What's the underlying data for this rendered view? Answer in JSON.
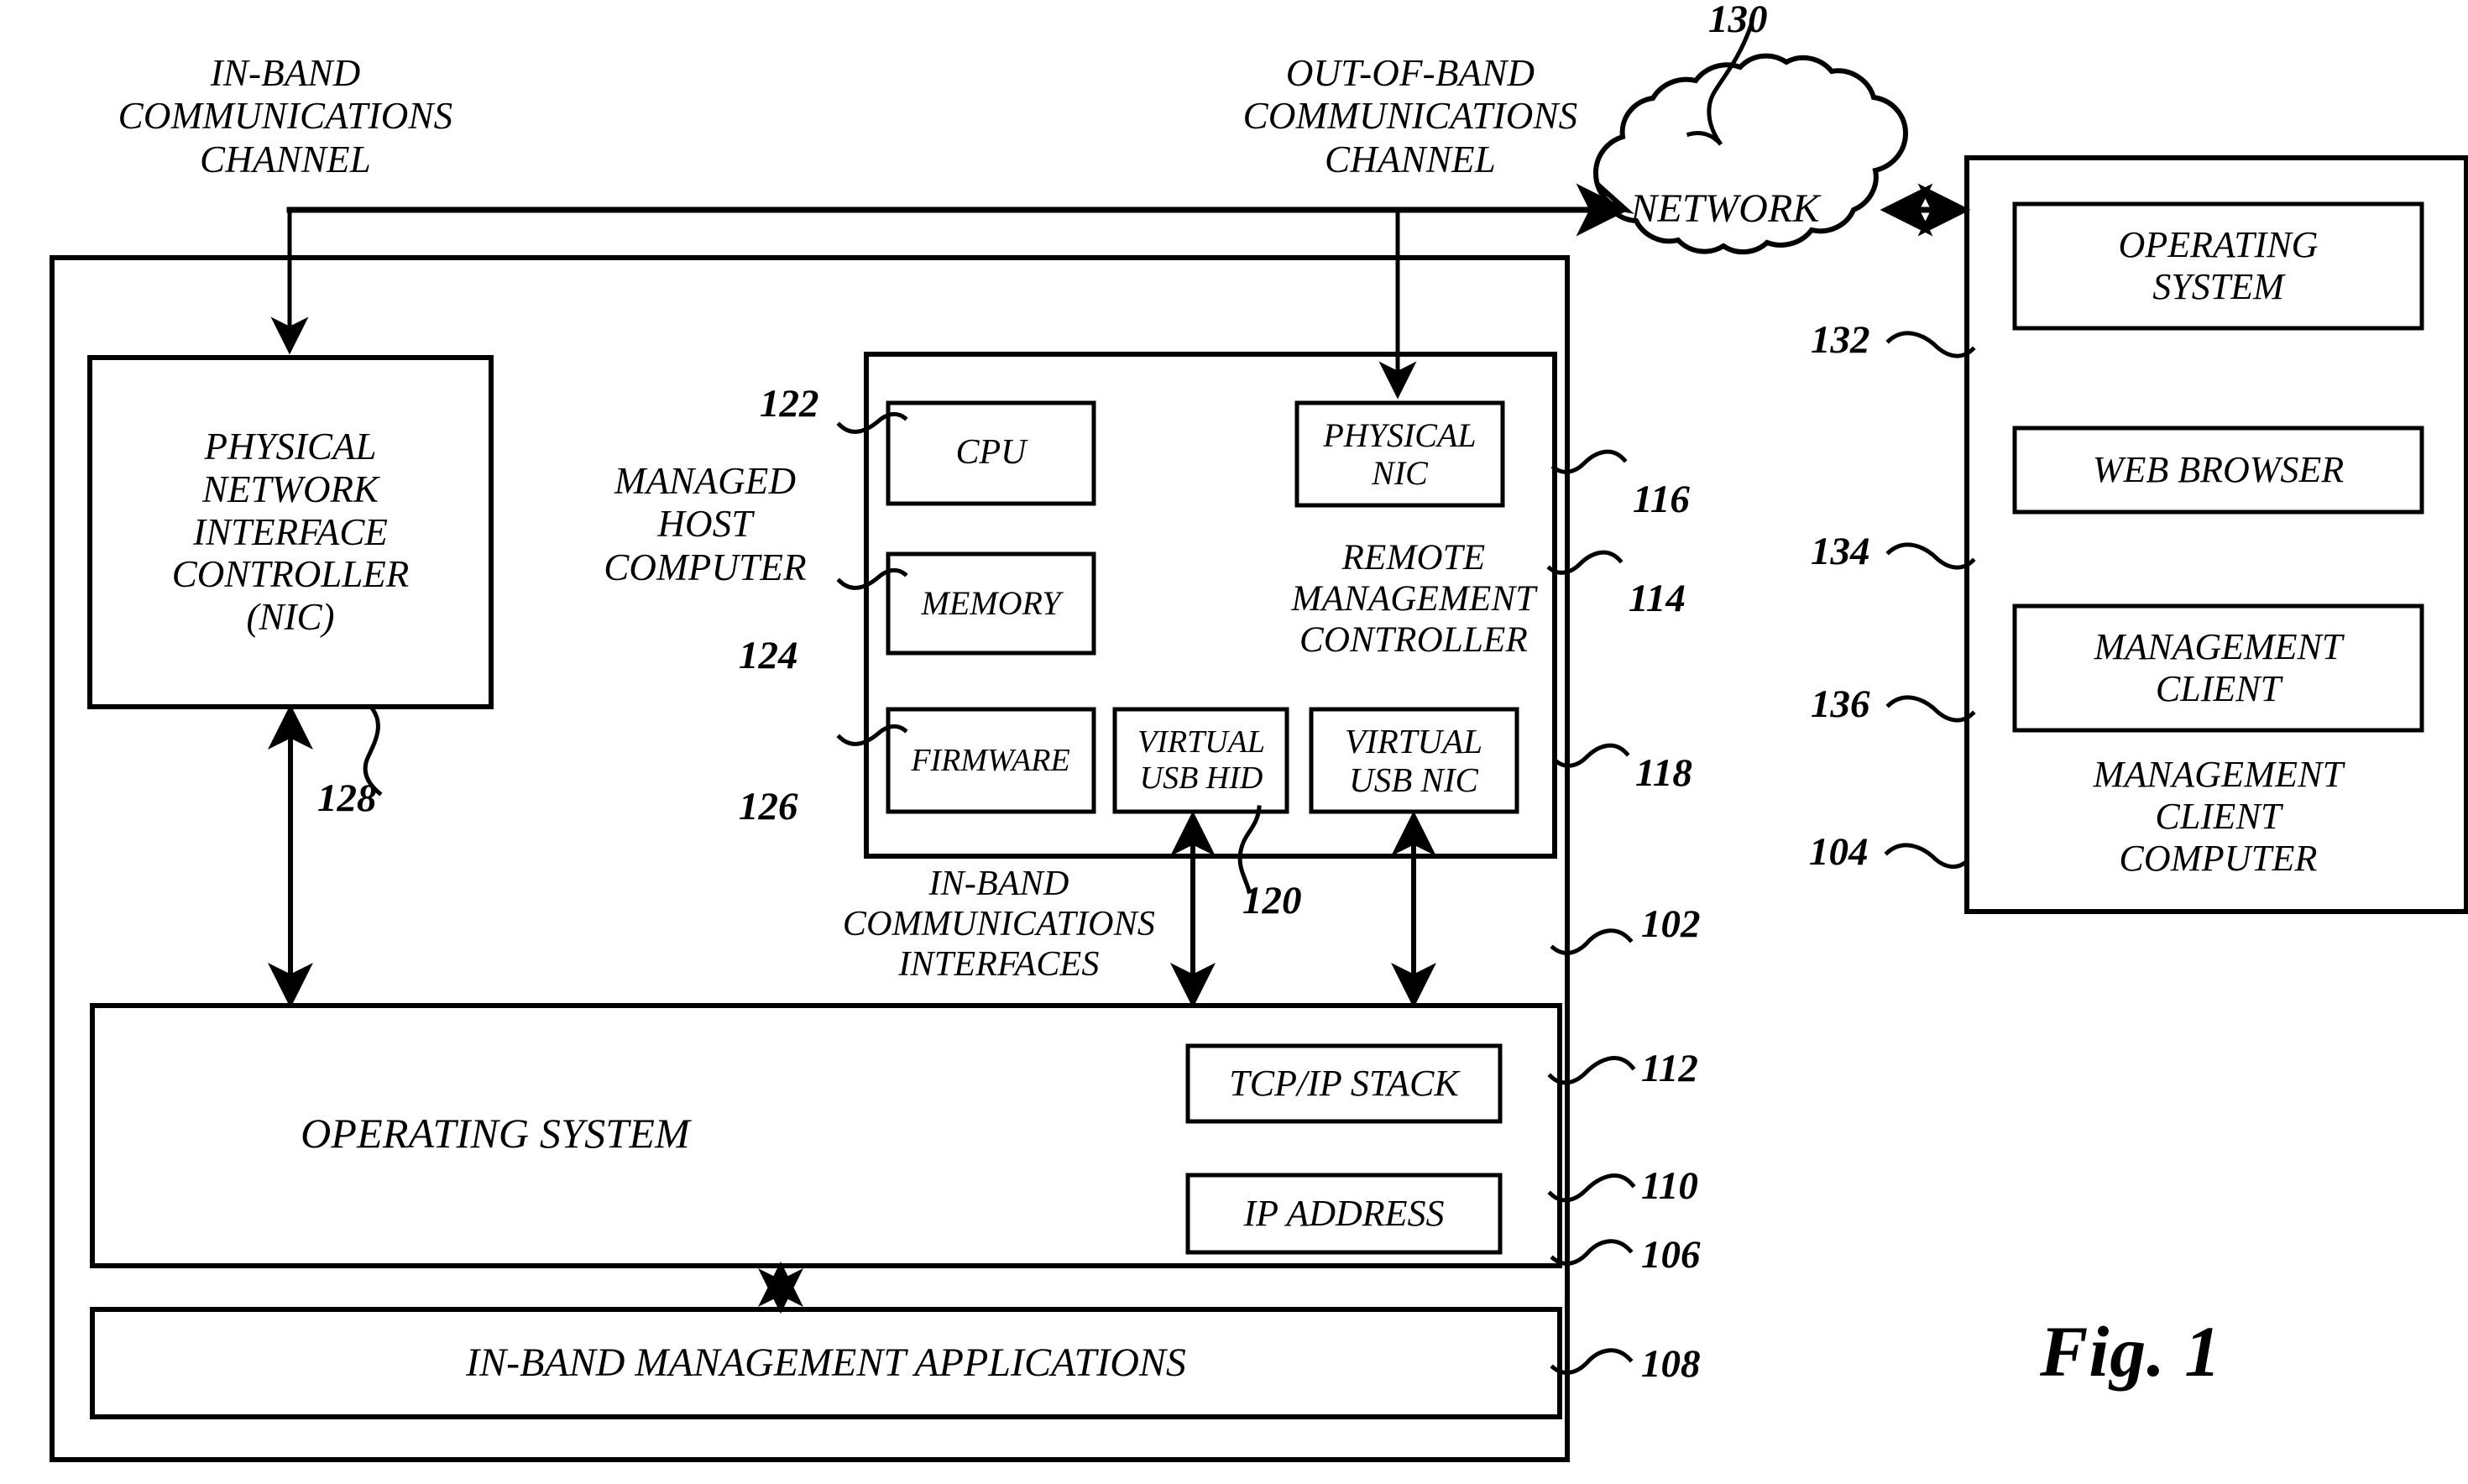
{
  "figure": {
    "title": "Fig. 1",
    "background_color": "#ffffff",
    "line_color": "#000000"
  },
  "channels": {
    "in_band_label": "IN-BAND\nCOMMUNICATIONS\nCHANNEL",
    "out_of_band_label": "OUT-OF-BAND\nCOMMUNICATIONS\nCHANNEL"
  },
  "network": {
    "label": "NETWORK",
    "ref": "130"
  },
  "managed_host": {
    "label": "MANAGED\nHOST\nCOMPUTER",
    "ref": "102",
    "physical_nic": {
      "label": "PHYSICAL\nNETWORK\nINTERFACE\nCONTROLLER\n(NIC)",
      "ref": "128"
    },
    "operating_system": {
      "label": "OPERATING SYSTEM",
      "ref": "106"
    },
    "tcpip_stack": {
      "label": "TCP/IP STACK",
      "ref": "112"
    },
    "ip_address": {
      "label": "IP ADDRESS",
      "ref": "110"
    },
    "in_band_apps": {
      "label": "IN-BAND MANAGEMENT APPLICATIONS",
      "ref": "108"
    },
    "in_band_interfaces_label": "IN-BAND\nCOMMUNICATIONS\nINTERFACES"
  },
  "remote_management_controller": {
    "label": "REMOTE\nMANAGEMENT\nCONTROLLER",
    "ref": "114",
    "components": [
      {
        "name": "cpu",
        "label": "CPU",
        "ref": "122"
      },
      {
        "name": "memory",
        "label": "MEMORY",
        "ref": "124"
      },
      {
        "name": "firmware",
        "label": "FIRMWARE",
        "ref": "126"
      },
      {
        "name": "physical-nic",
        "label": "PHYSICAL\nNIC",
        "ref": "116"
      },
      {
        "name": "virtual-usb-hid",
        "label": "VIRTUAL\nUSB HID",
        "ref": "120"
      },
      {
        "name": "virtual-usb-nic",
        "label": "VIRTUAL\nUSB NIC",
        "ref": "118"
      }
    ]
  },
  "management_client_computer": {
    "label": "MANAGEMENT\nCLIENT\nCOMPUTER",
    "ref": "104",
    "items": [
      {
        "name": "operating-system",
        "label": "OPERATING\nSYSTEM",
        "ref": "132"
      },
      {
        "name": "web-browser",
        "label": "WEB BROWSER",
        "ref": "134"
      },
      {
        "name": "management-client",
        "label": "MANAGEMENT\nCLIENT",
        "ref": "136"
      }
    ]
  }
}
